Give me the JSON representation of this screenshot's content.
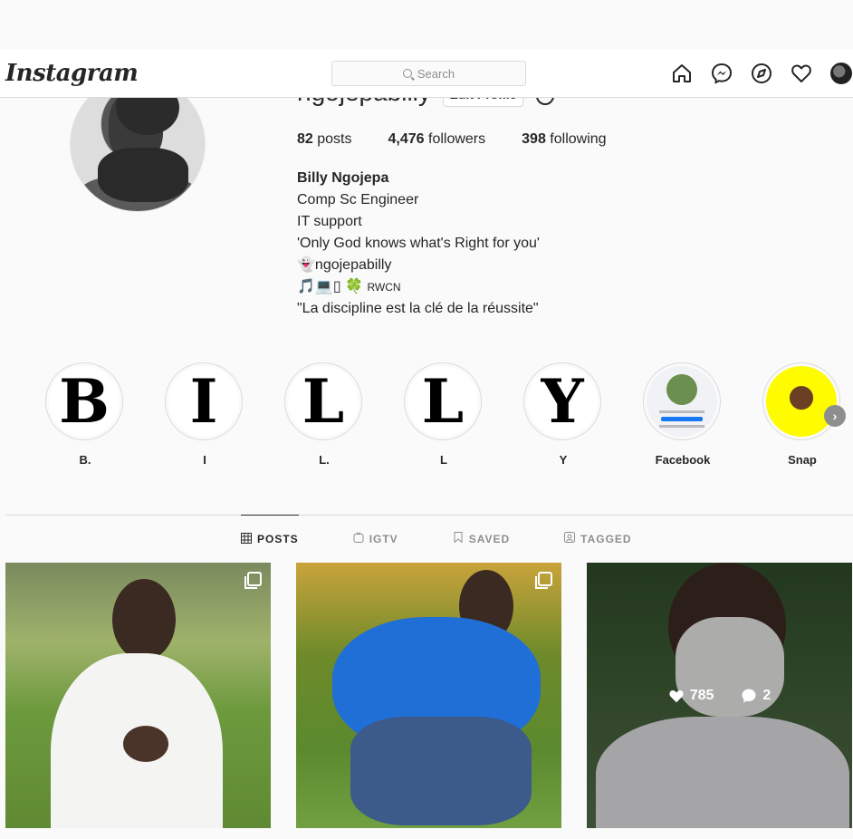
{
  "nav": {
    "logo": "Instagram",
    "search_placeholder": "Search",
    "icons": [
      "home-icon",
      "messenger-icon",
      "explore-icon",
      "heart-icon",
      "profile-avatar"
    ]
  },
  "profile": {
    "username": "ngojepabilly",
    "edit_profile_label": "Edit Profile",
    "stats": {
      "posts_count": "82",
      "posts_label": "posts",
      "followers_count": "4,476",
      "followers_label": "followers",
      "following_count": "398",
      "following_label": "following"
    },
    "bio": {
      "full_name": "Billy Ngojepa",
      "line1": "Comp Sc Engineer",
      "line2": "IT support",
      "line3": "'Only God knows what's Right for you'",
      "snap_emoji": "👻",
      "snap_handle": "ngojepabilly",
      "emoji_line": "🎵💻▯",
      "clover": "🍀",
      "rwcn": "RWCN",
      "line6": "\"La discipline est la clé de la réussite\""
    }
  },
  "highlights": [
    {
      "letter": "B",
      "label": "B."
    },
    {
      "letter": "I",
      "label": "I"
    },
    {
      "letter": "L",
      "label": "L."
    },
    {
      "letter": "L",
      "label": "L"
    },
    {
      "letter": "Y",
      "label": "Y"
    },
    {
      "letter": "",
      "label": "Facebook"
    },
    {
      "letter": "",
      "label": "Snap"
    }
  ],
  "tabs": [
    {
      "label": "POSTS",
      "icon": "grid-icon",
      "active": true
    },
    {
      "label": "IGTV",
      "icon": "igtv-icon",
      "active": false
    },
    {
      "label": "SAVED",
      "icon": "bookmark-icon",
      "active": false
    },
    {
      "label": "TAGGED",
      "icon": "tagged-icon",
      "active": false
    }
  ],
  "posts": [
    {
      "multi": true
    },
    {
      "multi": true
    },
    {
      "likes": "785",
      "comments": "2",
      "hovered": true
    }
  ]
}
